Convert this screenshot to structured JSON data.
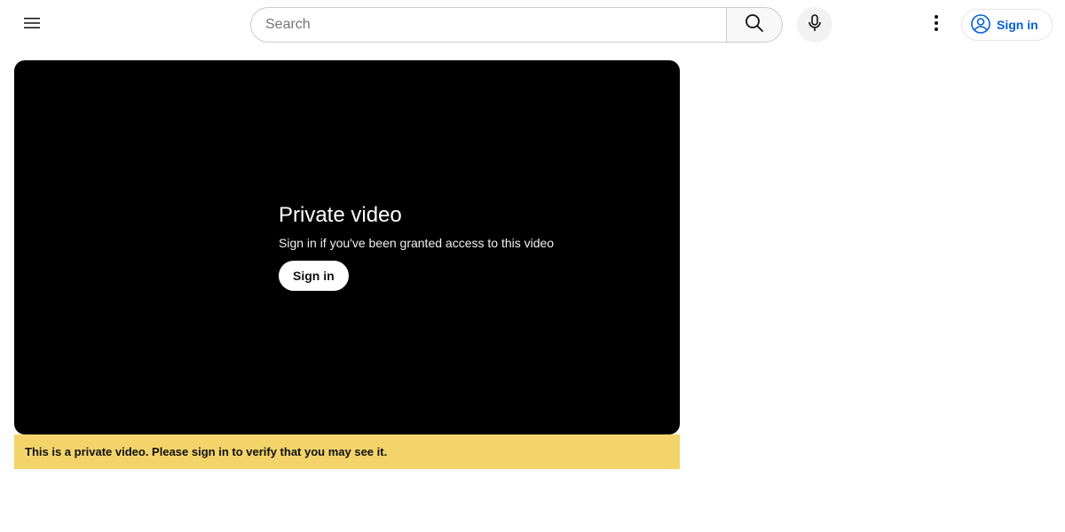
{
  "header": {
    "search_placeholder": "Search",
    "search_value": "",
    "signin_label": "Sign in",
    "icons": {
      "menu": "hamburger-menu-icon",
      "search": "search-icon",
      "mic": "microphone-icon",
      "more": "more-vert-icon",
      "account": "account-circle-icon"
    }
  },
  "player": {
    "title": "Private video",
    "subtitle": "Sign in if you've been granted access to this video",
    "signin_label": "Sign in"
  },
  "banner": {
    "message": "This is a private video. Please sign in to verify that you may see it."
  },
  "colors": {
    "accent": "#065fd4",
    "banner": "#f2d46b",
    "player_bg": "#000000"
  }
}
